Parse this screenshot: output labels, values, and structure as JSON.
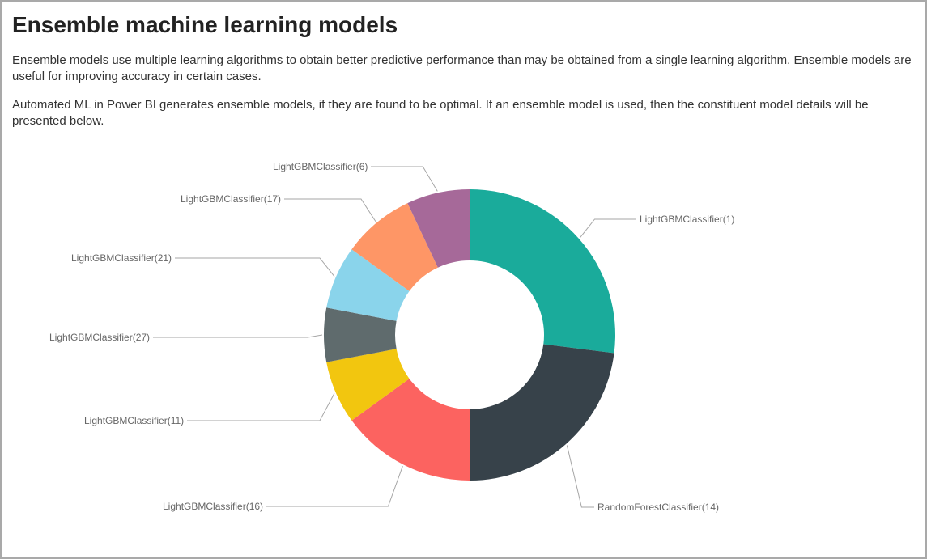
{
  "title": "Ensemble machine learning models",
  "paragraph1": "Ensemble models use multiple learning algorithms to obtain better predictive performance than may be obtained from a single learning algorithm. Ensemble models are useful for improving accuracy in certain cases.",
  "paragraph2": "Automated ML in Power BI generates ensemble models, if they are found to be optimal. If an ensemble model is used, then the constituent model details will be presented below.",
  "chart_data": {
    "type": "pie",
    "title": "",
    "slices": [
      {
        "name": "LightGBMClassifier(1)",
        "value": 27,
        "color": "#1aab9b"
      },
      {
        "name": "RandomForestClassifier(14)",
        "value": 23,
        "color": "#37424a"
      },
      {
        "name": "LightGBMClassifier(16)",
        "value": 15,
        "color": "#fc6360"
      },
      {
        "name": "LightGBMClassifier(11)",
        "value": 7,
        "color": "#f2c60f"
      },
      {
        "name": "LightGBMClassifier(27)",
        "value": 6,
        "color": "#5f6b6d"
      },
      {
        "name": "LightGBMClassifier(21)",
        "value": 7,
        "color": "#8ad4eb"
      },
      {
        "name": "LightGBMClassifier(17)",
        "value": 8,
        "color": "#fe9666"
      },
      {
        "name": "LightGBMClassifier(6)",
        "value": 7,
        "color": "#a66999"
      }
    ]
  }
}
